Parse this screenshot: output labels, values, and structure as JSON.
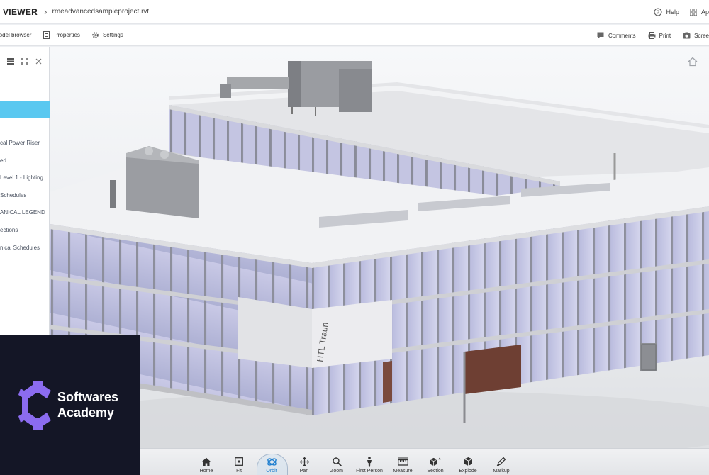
{
  "header": {
    "app_title": "VIEWER",
    "breadcrumb_sep": "›",
    "filename": "rmeadvancedsampleproject.rvt",
    "help_label": "Help",
    "apps_label": "Ap"
  },
  "toolbar": {
    "model_browser": "Model browser",
    "properties": "Properties",
    "settings": "Settings",
    "comments": "Comments",
    "print": "Print",
    "screenshot": "Scree"
  },
  "panel": {
    "items": [
      "cal Power Riser",
      "ed",
      "Level 1 - Lighting",
      "Schedules",
      "ANICAL LEGEND",
      "ections",
      "nical Schedules"
    ]
  },
  "bottom_tools": [
    {
      "label": "Home",
      "icon": "home-icon"
    },
    {
      "label": "Fit",
      "icon": "fit-icon"
    },
    {
      "label": "Orbit",
      "icon": "orbit-icon",
      "active": true
    },
    {
      "label": "Pan",
      "icon": "pan-icon"
    },
    {
      "label": "Zoom",
      "icon": "zoom-icon"
    },
    {
      "label": "First Person",
      "icon": "first-person-icon"
    },
    {
      "label": "Measure",
      "icon": "measure-icon"
    },
    {
      "label": "Section",
      "icon": "section-icon"
    },
    {
      "label": "Explode",
      "icon": "explode-icon"
    },
    {
      "label": "Markup",
      "icon": "markup-icon"
    }
  ],
  "model": {
    "sign_text": "HTL Traun"
  },
  "logo": {
    "line1": "Softwares",
    "line2": "Academy"
  },
  "colors": {
    "accent": "#5ac8f0",
    "active_tool": "#1f7fcf",
    "logo_bg": "#141626",
    "logo_gear": "#8b6cf0"
  }
}
